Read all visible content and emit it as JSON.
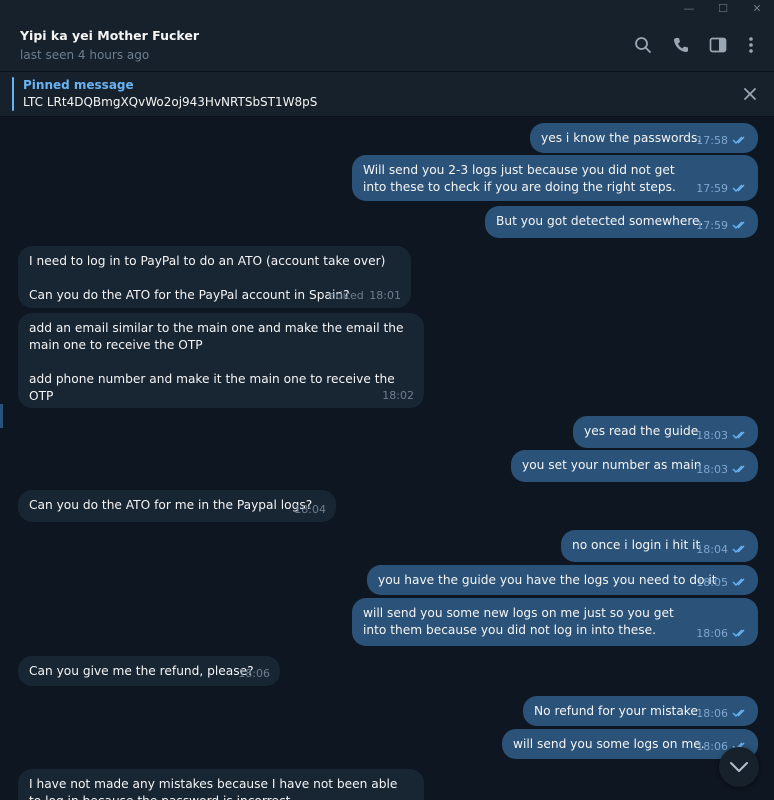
{
  "window": {
    "minimize_glyph": "—",
    "maximize_glyph": "☐",
    "close_glyph": "✕"
  },
  "header": {
    "title": "Yipi ka yei Mother Fucker",
    "status": "last seen 4 hours ago",
    "icons": [
      "search-icon",
      "phone-icon",
      "sidebar-toggle-icon",
      "more-vertical-icon"
    ]
  },
  "pinned": {
    "title": "Pinned message",
    "text": "LTC LRt4DQBmgXQvWo2oj943HvNRTSbST1W8pS"
  },
  "colors": {
    "background": "#0e1621",
    "header": "#17212b",
    "outgoing_bubble": "#2b5278",
    "incoming_bubble": "#182533",
    "accent": "#6ab3f3"
  },
  "messages": [
    {
      "dir": "out",
      "text": "yes i know the passwords.",
      "time": "17:58",
      "read": true
    },
    {
      "dir": "out",
      "text": "Will send you 2-3 logs just because you did not get into these to check if you are doing the right steps.",
      "time": "17:59",
      "read": true
    },
    {
      "dir": "out",
      "text": "But you got detected somewhere.",
      "time": "17:59",
      "read": true
    },
    {
      "dir": "in",
      "text": "I need to log in to PayPal to do an ATO (account take over)\n\nCan you do the ATO for the PayPal account in Spain?",
      "time": "18:01",
      "edited": "edited"
    },
    {
      "dir": "in",
      "text": "add an email similar to the main one and make the email the main one to receive the OTP\n\nadd phone number and make it the main one to receive the OTP",
      "time": "18:02"
    },
    {
      "dir": "out",
      "text": "yes read the guide",
      "time": "18:03",
      "read": true
    },
    {
      "dir": "out",
      "text": "you set your number as main",
      "time": "18:03",
      "read": true
    },
    {
      "dir": "in",
      "text": "Can you do the ATO for me in the Paypal logs?",
      "time": "18:04"
    },
    {
      "dir": "out",
      "text": "no once i login i hit it",
      "time": "18:04",
      "read": true
    },
    {
      "dir": "out",
      "text": "you have the guide you have the logs you need to do it",
      "time": "18:05",
      "read": true
    },
    {
      "dir": "out",
      "text": "will send you some new logs on me just so you get into them because you did not log in into these.",
      "time": "18:06",
      "read": true
    },
    {
      "dir": "in",
      "text": "Can you give me the refund, please?",
      "time": "18:06"
    },
    {
      "dir": "out",
      "text": "No refund for your mistake",
      "time": "18:06",
      "read": true
    },
    {
      "dir": "out",
      "text": "will send you some logs on me.",
      "time": "18:06",
      "read": true
    },
    {
      "dir": "in",
      "text": "I have not made any mistakes because I have not been able to log in because the password is incorrect",
      "time": ""
    }
  ]
}
